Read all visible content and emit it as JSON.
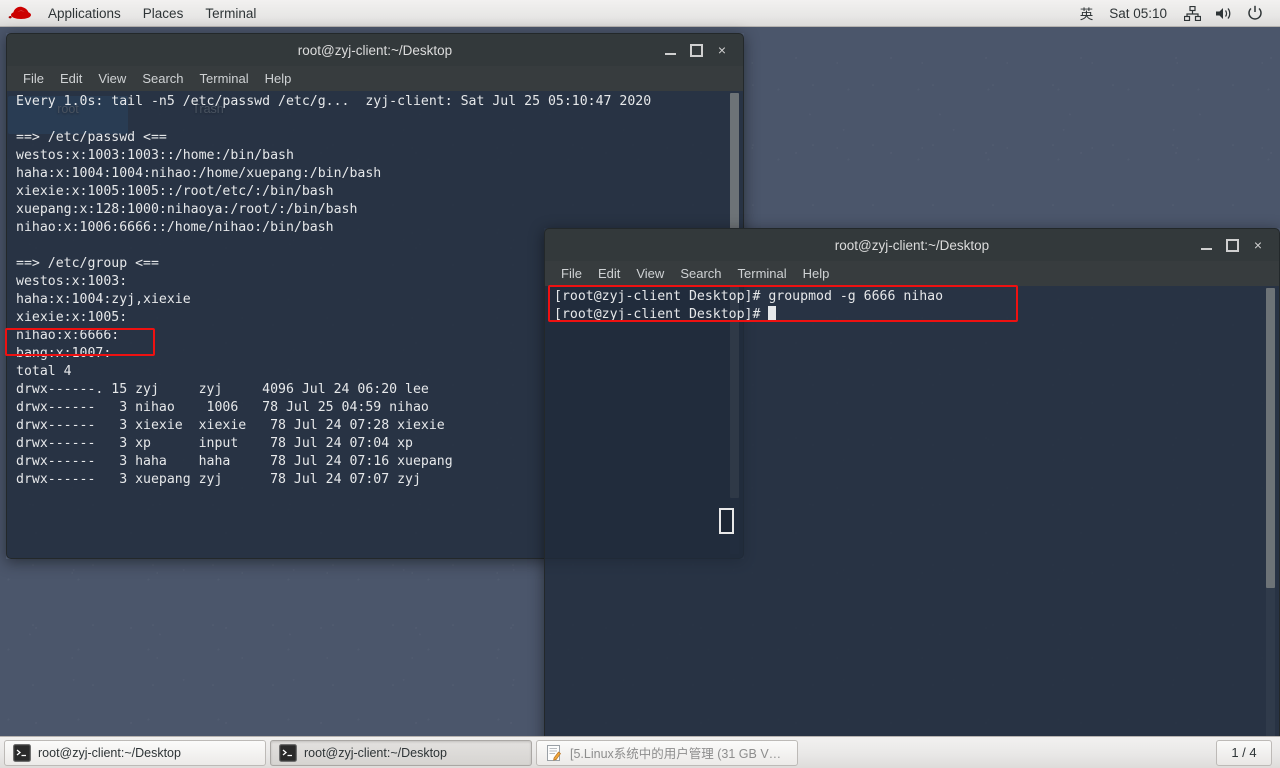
{
  "top_panel": {
    "logo_icon": "redhat-logo-icon",
    "menus": [
      "Applications",
      "Places",
      "Terminal"
    ],
    "ime_indicator": "英",
    "clock": "Sat 05:10",
    "tray": [
      {
        "name": "network-icon",
        "glyph": "network"
      },
      {
        "name": "volume-icon",
        "glyph": "volume"
      },
      {
        "name": "power-icon",
        "glyph": "power"
      }
    ]
  },
  "desktop_icons": [
    {
      "name": "root",
      "label": "root",
      "selected": true
    },
    {
      "name": "trash",
      "label": "Trash",
      "selected": false
    }
  ],
  "windows": [
    {
      "id": "win1",
      "title": "root@zyj-client:~/Desktop",
      "menus": [
        "File",
        "Edit",
        "View",
        "Search",
        "Terminal",
        "Help"
      ],
      "buttons": {
        "minimize": "–",
        "maximize": "□",
        "close": "×"
      },
      "content": "Every 1.0s: tail -n5 /etc/passwd /etc/g...  zyj-client: Sat Jul 25 05:10:47 2020\n\n==> /etc/passwd <==\nwestos:x:1003:1003::/home:/bin/bash\nhaha:x:1004:1004:nihao:/home/xuepang:/bin/bash\nxiexie:x:1005:1005::/root/etc/:/bin/bash\nxuepang:x:128:1000:nihaoya:/root/:/bin/bash\nnihao:x:1006:6666::/home/nihao:/bin/bash\n\n==> /etc/group <==\nwestos:x:1003:\nhaha:x:1004:zyj,xiexie\nxiexie:x:1005:\nnihao:x:6666:\nbang:x:1007:\ntotal 4\ndrwx------. 15 zyj     zyj     4096 Jul 24 06:20 lee\ndrwx------   3 nihao    1006   78 Jul 25 04:59 nihao\ndrwx------   3 xiexie  xiexie   78 Jul 24 07:28 xiexie\ndrwx------   3 xp      input    78 Jul 24 07:04 xp\ndrwx------   3 haha    haha     78 Jul 24 07:16 xuepang\ndrwx------   3 xuepang zyj      78 Jul 24 07:07 zyj"
    },
    {
      "id": "win2",
      "title": "root@zyj-client:~/Desktop",
      "menus": [
        "File",
        "Edit",
        "View",
        "Search",
        "Terminal",
        "Help"
      ],
      "buttons": {
        "minimize": "–",
        "maximize": "□",
        "close": "×"
      },
      "line1": "[root@zyj-client Desktop]# groupmod -g 6666 nihao",
      "line2": "[root@zyj-client Desktop]# "
    }
  ],
  "annotations": [
    {
      "name": "highlight-group-entry",
      "target": "nihao:x:6666:",
      "color": "#ee1111"
    },
    {
      "name": "highlight-groupmod-command",
      "target": "[root@zyj-client Desktop]# groupmod -g 6666 nihao",
      "color": "#ee1111"
    }
  ],
  "taskbar": {
    "items": [
      {
        "label": "root@zyj-client:~/Desktop",
        "icon": "terminal-icon",
        "active": false,
        "dim": false
      },
      {
        "label": "root@zyj-client:~/Desktop",
        "icon": "terminal-icon",
        "active": true,
        "dim": false
      },
      {
        "label": "[5.Linux系统中的用户管理 (31 GB V…",
        "icon": "notes-icon",
        "active": false,
        "dim": true
      }
    ],
    "workspace": "1 / 4"
  }
}
